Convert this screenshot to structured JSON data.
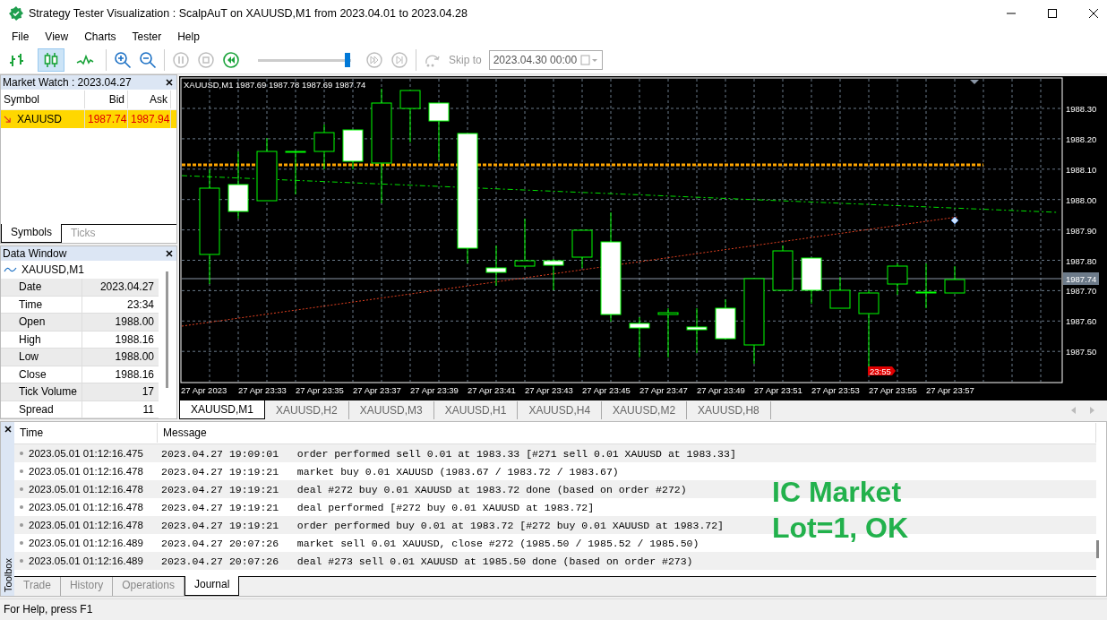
{
  "window": {
    "title": "Strategy Tester Visualization : ScalpAuT on XAUUSD,M1 from 2023.04.01 to 2023.04.28"
  },
  "menu": [
    "File",
    "View",
    "Charts",
    "Tester",
    "Help"
  ],
  "toolbar": {
    "chart_types": [
      {
        "kind": "bars",
        "selected": false
      },
      {
        "kind": "candles",
        "selected": true
      },
      {
        "kind": "line",
        "selected": false
      }
    ],
    "speed": {
      "level": 0.96
    },
    "skip_to": "Skip to",
    "skip_date": "2023.04.30 00:00"
  },
  "market_watch": {
    "title": "Market Watch : 2023.04.27",
    "columns": [
      "Symbol",
      "Bid",
      "Ask"
    ],
    "rows": [
      {
        "symbol": "XAUUSD",
        "bid": "1987.74",
        "ask": "1987.94",
        "selected": true
      }
    ],
    "tabs": [
      {
        "label": "Symbols",
        "selected": true
      },
      {
        "label": "Ticks",
        "selected": false
      }
    ]
  },
  "data_window": {
    "title": "Data Window",
    "symbol": "XAUUSD,M1",
    "rows": [
      {
        "label": "Date",
        "value": "2023.04.27"
      },
      {
        "label": "Time",
        "value": "23:34"
      },
      {
        "label": "Open",
        "value": "1988.00"
      },
      {
        "label": "High",
        "value": "1988.16"
      },
      {
        "label": "Low",
        "value": "1988.00"
      },
      {
        "label": "Close",
        "value": "1988.16"
      },
      {
        "label": "Tick Volume",
        "value": "17"
      },
      {
        "label": "Spread",
        "value": "11"
      }
    ]
  },
  "chart": {
    "header": "XAUUSD,M1  1987.69 1987.78 1987.69 1987.74",
    "price_labels": [
      "1988.30",
      "1988.20",
      "1988.10",
      "1988.00",
      "1987.90",
      "1987.80",
      "1987.70",
      "1987.60",
      "1987.50"
    ],
    "current_price": "1987.74",
    "time_labels": [
      "27 Apr 2023",
      "27 Apr 23:33",
      "27 Apr 23:35",
      "27 Apr 23:37",
      "27 Apr 23:39",
      "27 Apr 23:41",
      "27 Apr 23:43",
      "27 Apr 23:45",
      "27 Apr 23:47",
      "27 Apr 23:49",
      "27 Apr 23:51",
      "27 Apr 23:53",
      "27 Apr 23:55",
      "27 Apr 23:57"
    ],
    "marker_label": "23:55"
  },
  "chart_tabs": [
    {
      "label": "XAUUSD,M1",
      "selected": true
    },
    {
      "label": "XAUUSD,H2",
      "selected": false
    },
    {
      "label": "XAUUSD,M3",
      "selected": false
    },
    {
      "label": "XAUUSD,H1",
      "selected": false
    },
    {
      "label": "XAUUSD,H4",
      "selected": false
    },
    {
      "label": "XAUUSD,M2",
      "selected": false
    },
    {
      "label": "XAUUSD,H8",
      "selected": false
    }
  ],
  "toolbox": {
    "title": "Toolbox",
    "columns": [
      "Time",
      "Message"
    ],
    "rows": [
      {
        "time": "2023.05.01 01:12:16.475",
        "message": "2023.04.27 19:09:01   order performed sell 0.01 at 1983.33 [#271 sell 0.01 XAUUSD at 1983.33]"
      },
      {
        "time": "2023.05.01 01:12:16.478",
        "message": "2023.04.27 19:19:21   market buy 0.01 XAUUSD (1983.67 / 1983.72 / 1983.67)"
      },
      {
        "time": "2023.05.01 01:12:16.478",
        "message": "2023.04.27 19:19:21   deal #272 buy 0.01 XAUUSD at 1983.72 done (based on order #272)"
      },
      {
        "time": "2023.05.01 01:12:16.478",
        "message": "2023.04.27 19:19:21   deal performed [#272 buy 0.01 XAUUSD at 1983.72]"
      },
      {
        "time": "2023.05.01 01:12:16.478",
        "message": "2023.04.27 19:19:21   order performed buy 0.01 at 1983.72 [#272 buy 0.01 XAUUSD at 1983.72]"
      },
      {
        "time": "2023.05.01 01:12:16.489",
        "message": "2023.04.27 20:07:26   market sell 0.01 XAUUSD, close #272 (1985.50 / 1985.52 / 1985.50)"
      },
      {
        "time": "2023.05.01 01:12:16.489",
        "message": "2023.04.27 20:07:26   deal #273 sell 0.01 XAUUSD at 1985.50 done (based on order #273)"
      }
    ],
    "tabs": [
      {
        "label": "Trade",
        "selected": false
      },
      {
        "label": "History",
        "selected": false
      },
      {
        "label": "Operations",
        "selected": false
      },
      {
        "label": "Journal",
        "selected": true
      }
    ]
  },
  "annotation": [
    "IC Market",
    "Lot=1, OK"
  ],
  "status_bar": "For Help, press F1"
}
